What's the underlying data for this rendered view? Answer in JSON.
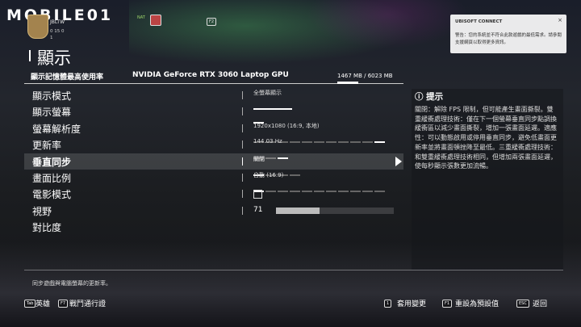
{
  "watermark": "MOBILE01",
  "profile": {
    "name": "JBLTW",
    "stats": "0  15  0",
    "level": "1",
    "nat_label": "NAT",
    "key_f2": "F2"
  },
  "toast": {
    "brand": "UBISOFT CONNECT",
    "message": "警告：您的系統並不符合此款遊戲的最低需求。請參閱支援網頁以取得更多資訊。",
    "close": "×"
  },
  "page": {
    "title": "顯示"
  },
  "vram": {
    "label": "顯示記憶體最高使用率",
    "gpu": "NVIDIA GeForce RTX 3060 Laptop GPU",
    "value": "1467 MB / 6023 MB",
    "fraction": 0.244
  },
  "settings": [
    {
      "label": "顯示模式",
      "value": "全螢幕顯示"
    },
    {
      "label": "顯示螢幕",
      "value": ""
    },
    {
      "label": "螢幕解析度",
      "value": "1920x1080 (16:9, 本地)"
    },
    {
      "label": "更新率",
      "value": "144.03 Hz"
    },
    {
      "label": "垂直同步",
      "value": "關閉"
    },
    {
      "label": "畫面比例",
      "value": "自動 (16:9)"
    },
    {
      "label": "電影模式",
      "value": ""
    },
    {
      "label": "視野",
      "value": "71"
    },
    {
      "label": "對比度",
      "value": ""
    }
  ],
  "fov_fraction": 0.37,
  "tip": {
    "title": "ⓘ 提示",
    "body": "關閉：解除 FPS 限制，但可能產生畫面撕裂。雙重緩衝處理技術：僅在下一個螢幕垂直同步點調換緩衝區以減少畫面撕裂，增加一張畫面延遲。適應性：可以動態啟用或停用垂直同步，避免低畫面更新率並將畫面頓挫降至最低。三重緩衝處理技術：和雙重緩衝處理技術相同，但增加兩張畫面延遲，使每秒顯示張數更加流暢。"
  },
  "description": "同步遊戲與電腦螢幕的更新率。",
  "footer": {
    "hero_key": "Tab",
    "hero_label": "英雄",
    "pass_key": "F7",
    "pass_label": "戰鬥通行證",
    "apply_key": "1",
    "apply_label": "套用變更",
    "default_key": "F1",
    "default_label": "重設為預設值",
    "back_key": "ESC",
    "back_label": "返回"
  }
}
